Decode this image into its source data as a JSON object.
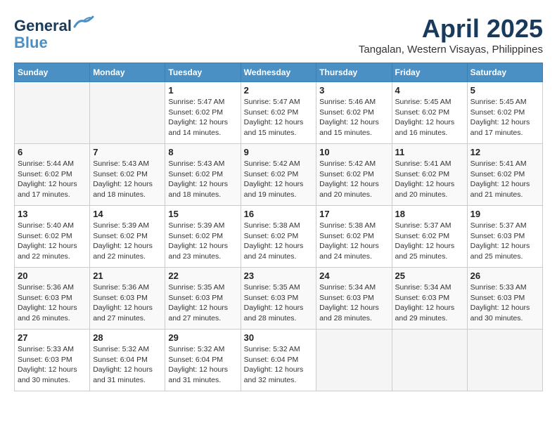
{
  "header": {
    "logo_line1": "General",
    "logo_line2": "Blue",
    "month_title": "April 2025",
    "location": "Tangalan, Western Visayas, Philippines"
  },
  "weekdays": [
    "Sunday",
    "Monday",
    "Tuesday",
    "Wednesday",
    "Thursday",
    "Friday",
    "Saturday"
  ],
  "weeks": [
    [
      {
        "day": "",
        "sunrise": "",
        "sunset": "",
        "daylight": ""
      },
      {
        "day": "",
        "sunrise": "",
        "sunset": "",
        "daylight": ""
      },
      {
        "day": "1",
        "sunrise": "Sunrise: 5:47 AM",
        "sunset": "Sunset: 6:02 PM",
        "daylight": "Daylight: 12 hours and 14 minutes."
      },
      {
        "day": "2",
        "sunrise": "Sunrise: 5:47 AM",
        "sunset": "Sunset: 6:02 PM",
        "daylight": "Daylight: 12 hours and 15 minutes."
      },
      {
        "day": "3",
        "sunrise": "Sunrise: 5:46 AM",
        "sunset": "Sunset: 6:02 PM",
        "daylight": "Daylight: 12 hours and 15 minutes."
      },
      {
        "day": "4",
        "sunrise": "Sunrise: 5:45 AM",
        "sunset": "Sunset: 6:02 PM",
        "daylight": "Daylight: 12 hours and 16 minutes."
      },
      {
        "day": "5",
        "sunrise": "Sunrise: 5:45 AM",
        "sunset": "Sunset: 6:02 PM",
        "daylight": "Daylight: 12 hours and 17 minutes."
      }
    ],
    [
      {
        "day": "6",
        "sunrise": "Sunrise: 5:44 AM",
        "sunset": "Sunset: 6:02 PM",
        "daylight": "Daylight: 12 hours and 17 minutes."
      },
      {
        "day": "7",
        "sunrise": "Sunrise: 5:43 AM",
        "sunset": "Sunset: 6:02 PM",
        "daylight": "Daylight: 12 hours and 18 minutes."
      },
      {
        "day": "8",
        "sunrise": "Sunrise: 5:43 AM",
        "sunset": "Sunset: 6:02 PM",
        "daylight": "Daylight: 12 hours and 18 minutes."
      },
      {
        "day": "9",
        "sunrise": "Sunrise: 5:42 AM",
        "sunset": "Sunset: 6:02 PM",
        "daylight": "Daylight: 12 hours and 19 minutes."
      },
      {
        "day": "10",
        "sunrise": "Sunrise: 5:42 AM",
        "sunset": "Sunset: 6:02 PM",
        "daylight": "Daylight: 12 hours and 20 minutes."
      },
      {
        "day": "11",
        "sunrise": "Sunrise: 5:41 AM",
        "sunset": "Sunset: 6:02 PM",
        "daylight": "Daylight: 12 hours and 20 minutes."
      },
      {
        "day": "12",
        "sunrise": "Sunrise: 5:41 AM",
        "sunset": "Sunset: 6:02 PM",
        "daylight": "Daylight: 12 hours and 21 minutes."
      }
    ],
    [
      {
        "day": "13",
        "sunrise": "Sunrise: 5:40 AM",
        "sunset": "Sunset: 6:02 PM",
        "daylight": "Daylight: 12 hours and 22 minutes."
      },
      {
        "day": "14",
        "sunrise": "Sunrise: 5:39 AM",
        "sunset": "Sunset: 6:02 PM",
        "daylight": "Daylight: 12 hours and 22 minutes."
      },
      {
        "day": "15",
        "sunrise": "Sunrise: 5:39 AM",
        "sunset": "Sunset: 6:02 PM",
        "daylight": "Daylight: 12 hours and 23 minutes."
      },
      {
        "day": "16",
        "sunrise": "Sunrise: 5:38 AM",
        "sunset": "Sunset: 6:02 PM",
        "daylight": "Daylight: 12 hours and 24 minutes."
      },
      {
        "day": "17",
        "sunrise": "Sunrise: 5:38 AM",
        "sunset": "Sunset: 6:02 PM",
        "daylight": "Daylight: 12 hours and 24 minutes."
      },
      {
        "day": "18",
        "sunrise": "Sunrise: 5:37 AM",
        "sunset": "Sunset: 6:02 PM",
        "daylight": "Daylight: 12 hours and 25 minutes."
      },
      {
        "day": "19",
        "sunrise": "Sunrise: 5:37 AM",
        "sunset": "Sunset: 6:03 PM",
        "daylight": "Daylight: 12 hours and 25 minutes."
      }
    ],
    [
      {
        "day": "20",
        "sunrise": "Sunrise: 5:36 AM",
        "sunset": "Sunset: 6:03 PM",
        "daylight": "Daylight: 12 hours and 26 minutes."
      },
      {
        "day": "21",
        "sunrise": "Sunrise: 5:36 AM",
        "sunset": "Sunset: 6:03 PM",
        "daylight": "Daylight: 12 hours and 27 minutes."
      },
      {
        "day": "22",
        "sunrise": "Sunrise: 5:35 AM",
        "sunset": "Sunset: 6:03 PM",
        "daylight": "Daylight: 12 hours and 27 minutes."
      },
      {
        "day": "23",
        "sunrise": "Sunrise: 5:35 AM",
        "sunset": "Sunset: 6:03 PM",
        "daylight": "Daylight: 12 hours and 28 minutes."
      },
      {
        "day": "24",
        "sunrise": "Sunrise: 5:34 AM",
        "sunset": "Sunset: 6:03 PM",
        "daylight": "Daylight: 12 hours and 28 minutes."
      },
      {
        "day": "25",
        "sunrise": "Sunrise: 5:34 AM",
        "sunset": "Sunset: 6:03 PM",
        "daylight": "Daylight: 12 hours and 29 minutes."
      },
      {
        "day": "26",
        "sunrise": "Sunrise: 5:33 AM",
        "sunset": "Sunset: 6:03 PM",
        "daylight": "Daylight: 12 hours and 30 minutes."
      }
    ],
    [
      {
        "day": "27",
        "sunrise": "Sunrise: 5:33 AM",
        "sunset": "Sunset: 6:03 PM",
        "daylight": "Daylight: 12 hours and 30 minutes."
      },
      {
        "day": "28",
        "sunrise": "Sunrise: 5:32 AM",
        "sunset": "Sunset: 6:04 PM",
        "daylight": "Daylight: 12 hours and 31 minutes."
      },
      {
        "day": "29",
        "sunrise": "Sunrise: 5:32 AM",
        "sunset": "Sunset: 6:04 PM",
        "daylight": "Daylight: 12 hours and 31 minutes."
      },
      {
        "day": "30",
        "sunrise": "Sunrise: 5:32 AM",
        "sunset": "Sunset: 6:04 PM",
        "daylight": "Daylight: 12 hours and 32 minutes."
      },
      {
        "day": "",
        "sunrise": "",
        "sunset": "",
        "daylight": ""
      },
      {
        "day": "",
        "sunrise": "",
        "sunset": "",
        "daylight": ""
      },
      {
        "day": "",
        "sunrise": "",
        "sunset": "",
        "daylight": ""
      }
    ]
  ]
}
